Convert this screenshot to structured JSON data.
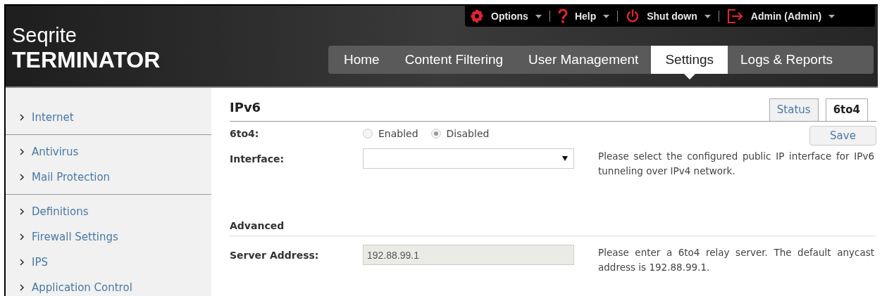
{
  "brand": {
    "line1": "Seqrite",
    "line2": "TERMINATOR"
  },
  "top_menu": [
    {
      "kind": "gear",
      "label": "Options"
    },
    {
      "kind": "help",
      "label": "Help"
    },
    {
      "kind": "power",
      "label": "Shut down"
    },
    {
      "kind": "logout",
      "label": "Admin (Admin)"
    }
  ],
  "nav": [
    {
      "label": "Home",
      "selected": false
    },
    {
      "label": "Content Filtering",
      "selected": false
    },
    {
      "label": "User Management",
      "selected": false
    },
    {
      "label": "Settings",
      "selected": true
    },
    {
      "label": "Logs & Reports",
      "selected": false
    }
  ],
  "sidebar": {
    "groups": [
      {
        "items": [
          "Internet"
        ]
      },
      {
        "items": [
          "Antivirus",
          "Mail Protection"
        ]
      },
      {
        "items": [
          "Definitions",
          "Firewall Settings",
          "IPS",
          "Application Control"
        ]
      }
    ]
  },
  "page": {
    "title": "IPv6",
    "tabs": [
      {
        "label": "Status",
        "selected": false
      },
      {
        "label": "6to4",
        "selected": true
      }
    ],
    "save_button": "Save",
    "mode": {
      "label": "6to4:",
      "options": [
        {
          "label": "Enabled",
          "selected": false
        },
        {
          "label": "Disabled",
          "selected": true
        }
      ]
    },
    "interface": {
      "label": "Interface:",
      "help": "Please select the configured public IP interface for IPv6 tunneling over IPv4 network."
    },
    "advanced": {
      "title": "Advanced",
      "server_address": {
        "label": "Server Address:",
        "value": "192.88.99.1",
        "disabled": true,
        "help": "Please enter a 6to4 relay server. The default anycast address is 192.88.99.1."
      }
    }
  }
}
